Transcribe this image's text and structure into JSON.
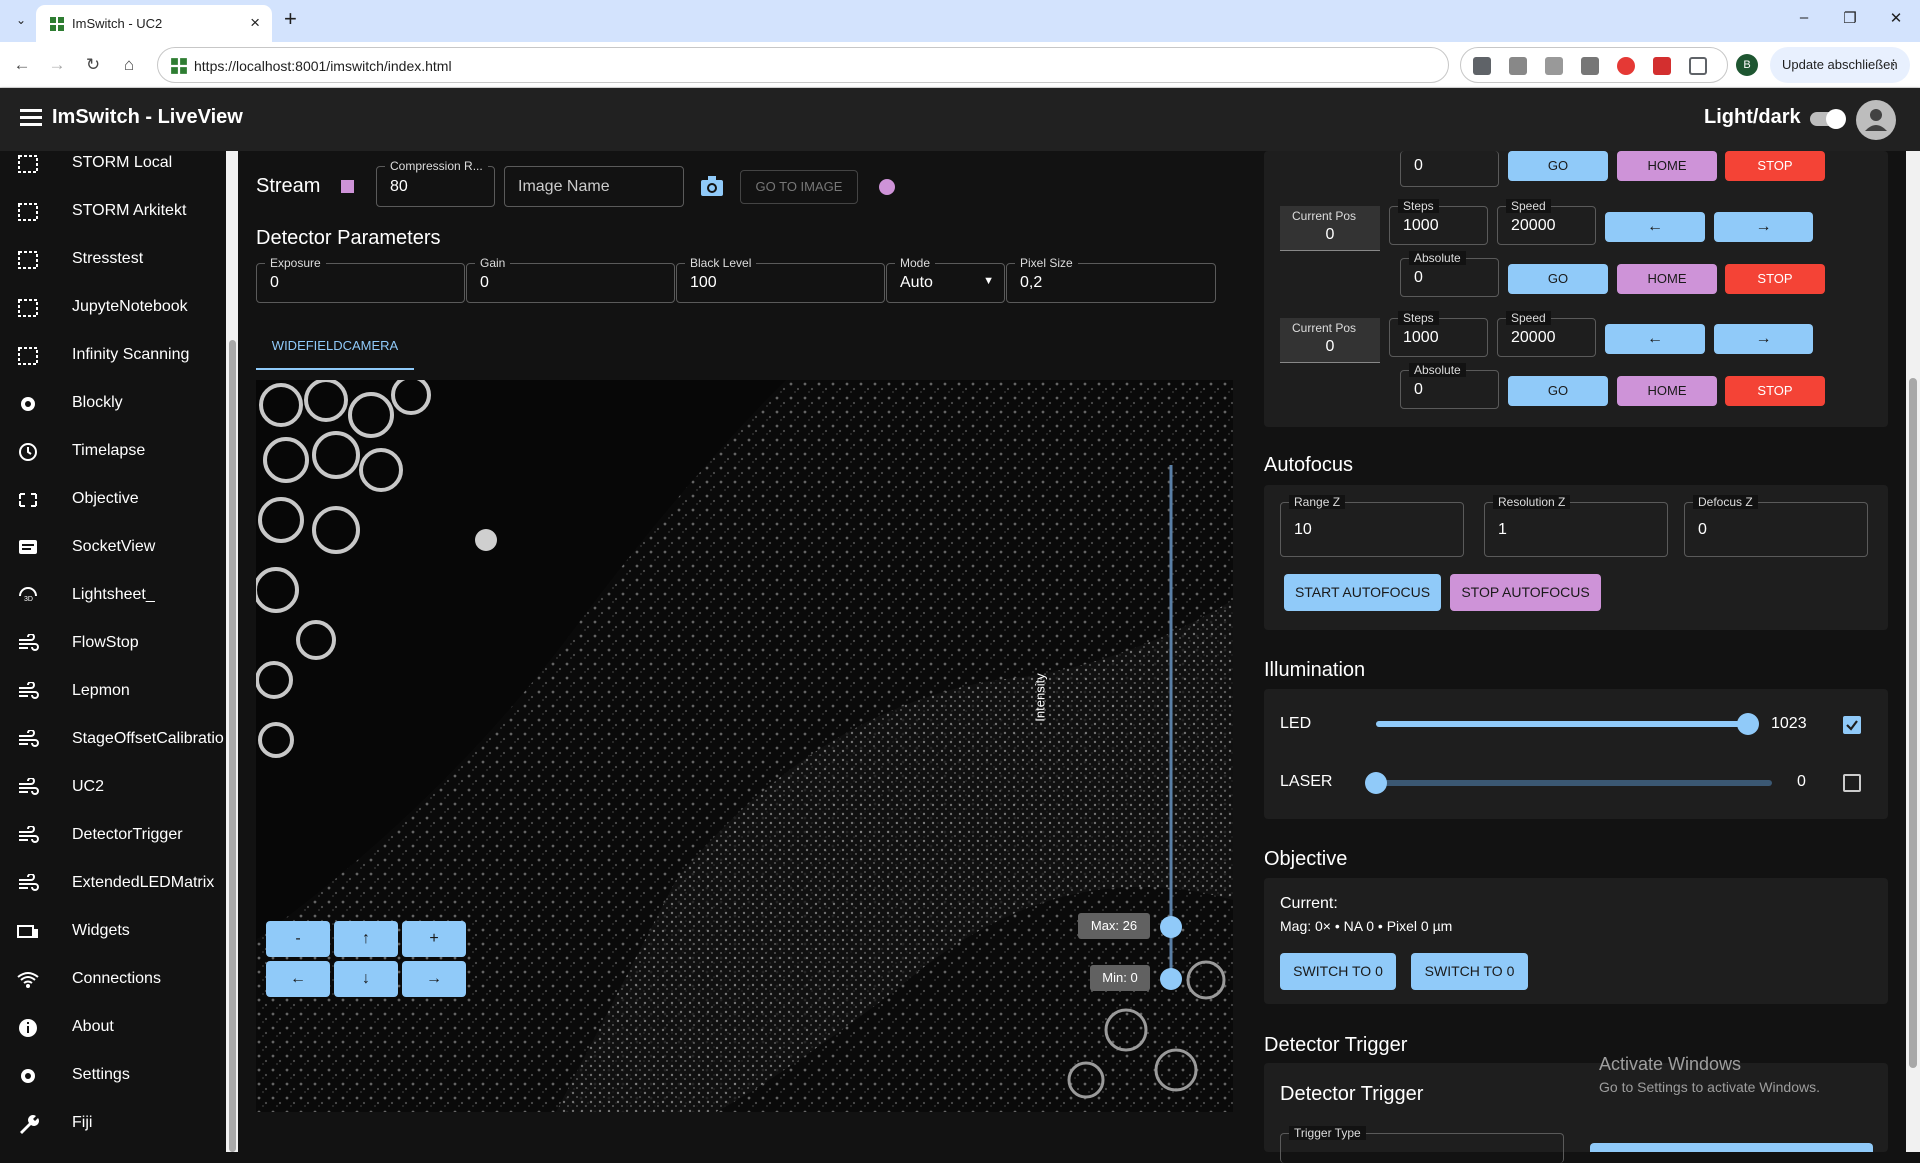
{
  "browser": {
    "tab_title": "ImSwitch - UC2",
    "url": "https://localhost:8001/imswitch/index.html",
    "update_label": "Update abschließen",
    "profile_initial": "B",
    "colors": {
      "tabbar": "#d3e3fd"
    }
  },
  "appbar": {
    "title": "ImSwitch - LiveView",
    "theme_label": "Light/dark"
  },
  "sidebar": {
    "items": [
      {
        "label": "STORM Local",
        "icon": "grid-icon"
      },
      {
        "label": "STORM Arkitekt",
        "icon": "grid-icon"
      },
      {
        "label": "Stresstest",
        "icon": "grid-icon"
      },
      {
        "label": "JupyteNotebook",
        "icon": "grid-icon"
      },
      {
        "label": "Infinity Scanning",
        "icon": "grid-icon"
      },
      {
        "label": "Blockly",
        "icon": "gear-icon"
      },
      {
        "label": "Timelapse",
        "icon": "clock-icon"
      },
      {
        "label": "Objective",
        "icon": "expand-icon"
      },
      {
        "label": "SocketView",
        "icon": "chat-icon"
      },
      {
        "label": "Lightsheet_",
        "icon": "3d-rotation-icon"
      },
      {
        "label": "FlowStop",
        "icon": "air-icon"
      },
      {
        "label": "Lepmon",
        "icon": "air-icon"
      },
      {
        "label": "StageOffsetCalibratio",
        "icon": "air-icon"
      },
      {
        "label": "UC2",
        "icon": "air-icon"
      },
      {
        "label": "DetectorTrigger",
        "icon": "air-icon"
      },
      {
        "label": "ExtendedLEDMatrix",
        "icon": "air-icon"
      },
      {
        "label": "Widgets",
        "icon": "devices-icon"
      },
      {
        "label": "Connections",
        "icon": "wifi-icon"
      },
      {
        "label": "About",
        "icon": "info-icon"
      },
      {
        "label": "Settings",
        "icon": "gear-icon"
      },
      {
        "label": "Fiji",
        "icon": "wrench-icon"
      }
    ]
  },
  "stream": {
    "label": "Stream",
    "compression_label": "Compression R...",
    "compression_value": "80",
    "image_name_placeholder": "Image Name",
    "goto_label": "GO TO IMAGE"
  },
  "detector": {
    "title": "Detector Parameters",
    "exposure_label": "Exposure",
    "exposure": "0",
    "gain_label": "Gain",
    "gain": "0",
    "black_label": "Black Level",
    "black": "100",
    "mode_label": "Mode",
    "mode": "Auto",
    "pixel_label": "Pixel Size",
    "pixel": "0,2"
  },
  "camera_tab": "WIDEFIELDCAMERA",
  "stage_buttons": {
    "minus": "-",
    "up": "↑",
    "plus": "+",
    "left": "←",
    "down": "↓",
    "right": "→"
  },
  "intensity": {
    "label": "Intensity",
    "max": "Max: 26",
    "min": "Min: 0"
  },
  "motors": {
    "top_value": "0",
    "rows": [
      {
        "cur_label": "Current Pos",
        "cur": "0",
        "steps_label": "Steps",
        "steps": "1000",
        "speed_label": "Speed",
        "speed": "20000",
        "abs_label": "Absolute",
        "abs": "0"
      },
      {
        "cur_label": "Current Pos",
        "cur": "0",
        "steps_label": "Steps",
        "steps": "1000",
        "speed_label": "Speed",
        "speed": "20000",
        "abs_label": "Absolute",
        "abs": "0"
      }
    ],
    "go": "GO",
    "home": "HOME",
    "stop": "STOP",
    "left": "←",
    "right": "→"
  },
  "autofocus": {
    "title": "Autofocus",
    "range_label": "Range Z",
    "range": "10",
    "res_label": "Resolution Z",
    "res": "1",
    "defocus_label": "Defocus Z",
    "defocus": "0",
    "start": "START AUTOFOCUS",
    "stop": "STOP AUTOFOCUS"
  },
  "illumination": {
    "title": "Illumination",
    "led_label": "LED",
    "led_value": "1023",
    "led_fraction": 1.0,
    "laser_label": "LASER",
    "laser_value": "0",
    "laser_fraction": 0.0
  },
  "objective": {
    "title": "Objective",
    "current_label": "Current:",
    "details": "Mag: 0× • NA 0 • Pixel 0 µm",
    "btn1": "SWITCH TO 0",
    "btn2": "SWITCH TO 0"
  },
  "trigger": {
    "title": "Detector Trigger",
    "inner_title": "Detector Trigger",
    "type_label": "Trigger Type"
  },
  "watermark": {
    "line1": "Activate Windows",
    "line2": "Go to Settings to activate Windows."
  }
}
